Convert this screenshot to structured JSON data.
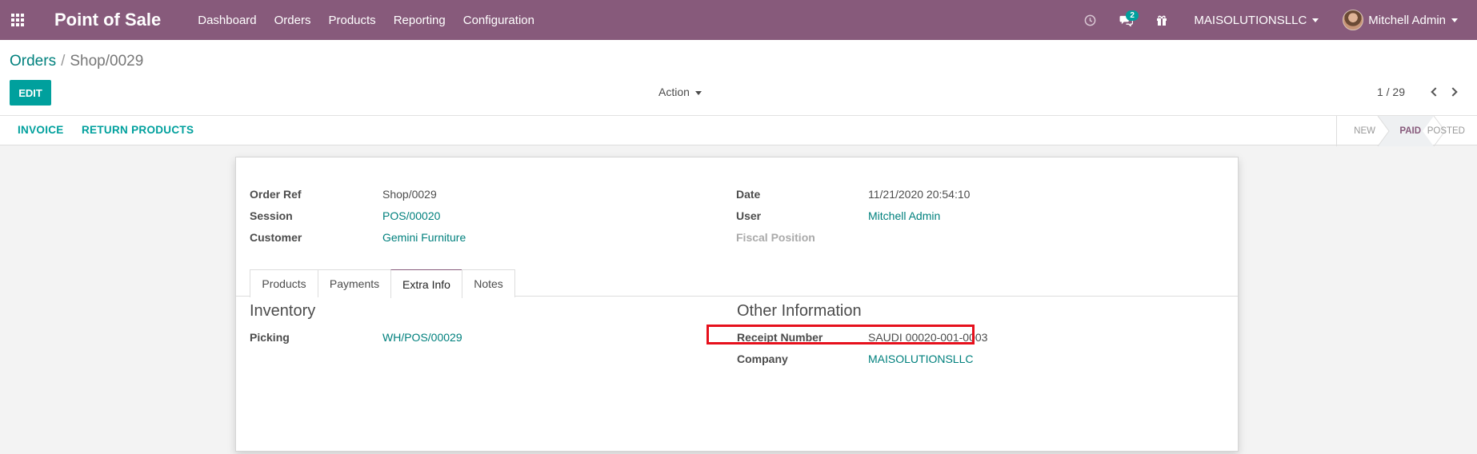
{
  "navbar": {
    "brand": "Point of Sale",
    "menu": [
      "Dashboard",
      "Orders",
      "Products",
      "Reporting",
      "Configuration"
    ],
    "messages_count": "2",
    "company": "MAISOLUTIONSLLC",
    "user": "Mitchell Admin",
    "colors": {
      "background": "#875a7b",
      "accent": "#00a09d"
    }
  },
  "control_panel": {
    "breadcrumb": {
      "parent": "Orders",
      "current": "Shop/0029"
    },
    "edit_label": "EDIT",
    "action_label": "Action",
    "pager": "1 / 29",
    "header_buttons": [
      "INVOICE",
      "RETURN PRODUCTS"
    ],
    "statuses": [
      "NEW",
      "PAID",
      "POSTED"
    ],
    "active_status": "PAID"
  },
  "form": {
    "left": [
      {
        "label": "Order Ref",
        "value": "Shop/0029"
      },
      {
        "label": "Session",
        "value": "POS/00020"
      },
      {
        "label": "Customer",
        "value": "Gemini Furniture"
      }
    ],
    "right": [
      {
        "label": "Date",
        "value": "11/21/2020 20:54:10"
      },
      {
        "label": "User",
        "value": "Mitchell Admin"
      },
      {
        "label": "Fiscal Position",
        "value": ""
      }
    ],
    "tabs": [
      "Products",
      "Payments",
      "Extra Info",
      "Notes"
    ],
    "active_tab": "Extra Info",
    "inventory": {
      "title": "Inventory",
      "picking_label": "Picking",
      "picking_value": "WH/POS/00029"
    },
    "other_info": {
      "title": "Other Information",
      "receipt_label": "Receipt Number",
      "receipt_value": "SAUDI 00020-001-0003",
      "company_label": "Company",
      "company_value": "MAISOLUTIONSLLC"
    }
  }
}
